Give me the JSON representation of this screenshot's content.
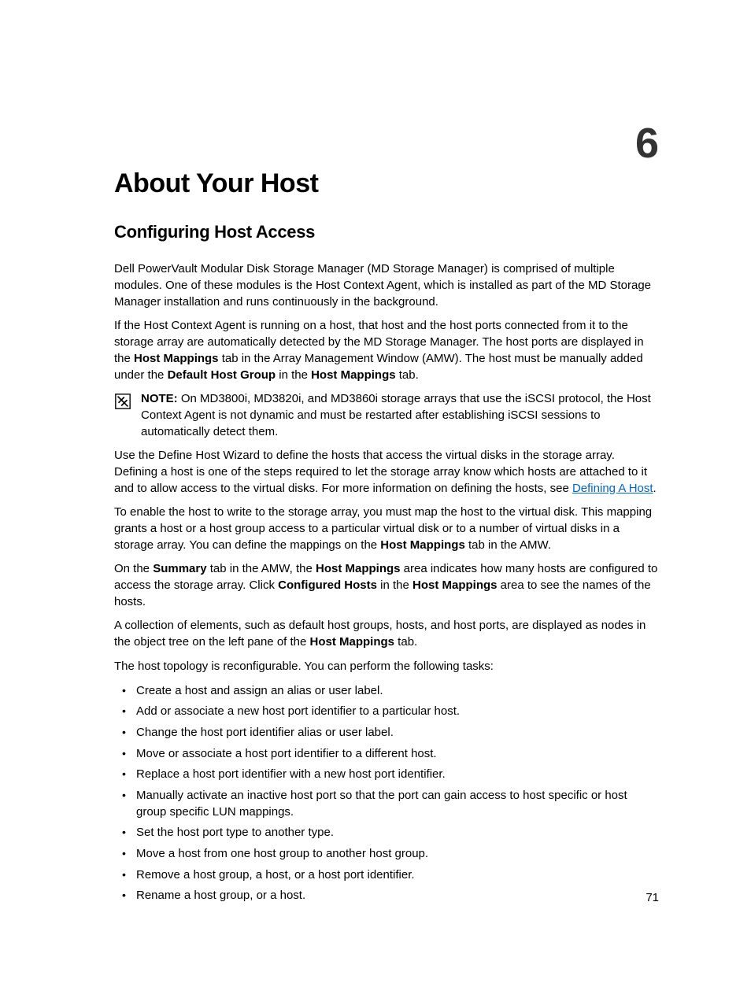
{
  "chapterNumber": "6",
  "title": "About Your Host",
  "subtitle": "Configuring Host Access",
  "para1": "Dell PowerVault Modular Disk Storage Manager (MD Storage Manager) is comprised of multiple modules. One of these modules is the Host Context Agent, which is installed as part of the MD Storage Manager installation and runs continuously in the background.",
  "para2_a": "If the Host Context Agent is running on a host, that host and the host ports connected from it to the storage array are automatically detected by the MD Storage Manager. The host ports are displayed in the ",
  "para2_b1": "Host Mappings",
  "para2_c": " tab in the Array Management Window (AMW). The host must be manually added under the ",
  "para2_b2": "Default Host Group",
  "para2_d": " in the ",
  "para2_b3": "Host Mappings",
  "para2_e": " tab.",
  "noteLabel": "NOTE:",
  "noteText": " On MD3800i, MD3820i, and MD3860i storage arrays that use the iSCSI protocol, the Host Context Agent is not dynamic and must be restarted after establishing iSCSI sessions to automatically detect them.",
  "para3_a": "Use the Define Host Wizard to define the hosts that access the virtual disks in the storage array. Defining a host is one of the steps required to let the storage array know which hosts are attached to it and to allow access to the virtual disks. For more information on defining the hosts, see ",
  "para3_link": "Defining A Host",
  "para3_b": ".",
  "para4_a": "To enable the host to write to the storage array, you must map the host to the virtual disk. This mapping grants a host or a host group access to a particular virtual disk or to a number of virtual disks in a storage array. You can define the mappings on the ",
  "para4_b1": "Host Mappings",
  "para4_b": " tab in the AMW.",
  "para5_a": "On the ",
  "para5_b1": "Summary",
  "para5_b": " tab in the AMW, the ",
  "para5_b2": "Host Mappings",
  "para5_c": " area indicates how many hosts are configured to access the storage array. Click ",
  "para5_b3": "Configured Hosts",
  "para5_d": " in the ",
  "para5_b4": "Host Mappings",
  "para5_e": " area to see the names of the hosts.",
  "para6_a": "A collection of elements, such as default host groups, hosts, and host ports, are displayed as nodes in the object tree on the left pane of the ",
  "para6_b1": "Host Mappings",
  "para6_b": " tab.",
  "para7": "The host topology is reconfigurable. You can perform the following tasks:",
  "list": [
    "Create a host and assign an alias or user label.",
    "Add or associate a new host port identifier to a particular host.",
    "Change the host port identifier alias or user label.",
    "Move or associate a host port identifier to a different host.",
    "Replace a host port identifier with a new host port identifier.",
    "Manually activate an inactive host port so that the port can gain access to host specific or host group specific LUN mappings.",
    "Set the host port type to another type.",
    "Move a host from one host group to another host group.",
    "Remove a host group, a host, or a host port identifier.",
    "Rename a host group, or a host."
  ],
  "pageNumber": "71"
}
